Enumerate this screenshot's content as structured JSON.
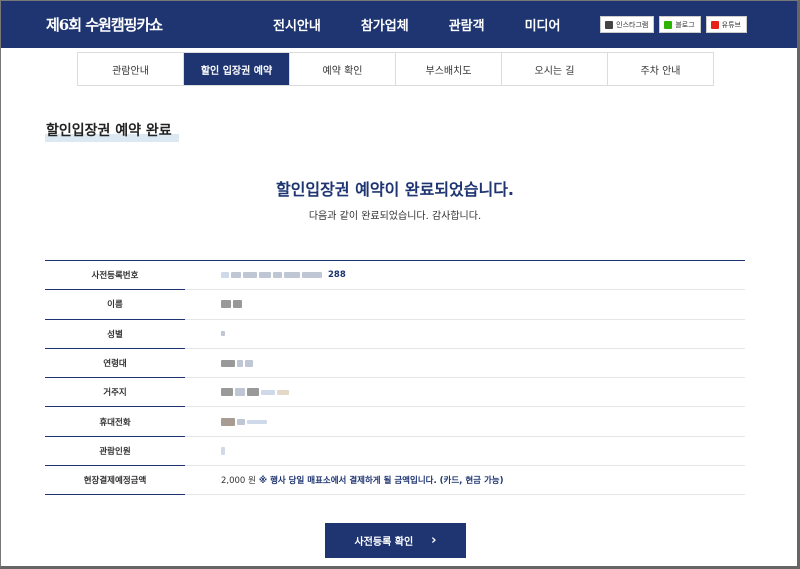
{
  "header": {
    "logo": "제6회 수원캠핑카쇼",
    "nav": [
      "전시안내",
      "참가업체",
      "관람객",
      "미디어"
    ],
    "social": [
      {
        "label": "인스타그램",
        "icon": "instagram-icon",
        "color": "#444444"
      },
      {
        "label": "블로그",
        "icon": "blog-icon",
        "color": "#2db400"
      },
      {
        "label": "유튜브",
        "icon": "youtube-icon",
        "color": "#e62117"
      }
    ]
  },
  "subtabs": {
    "items": [
      "관람안내",
      "할인 입장권 예약",
      "예약 확인",
      "부스배치도",
      "오시는 길",
      "주차 안내"
    ],
    "active_index": 1
  },
  "section": {
    "title": "할인입장권 예약 완료"
  },
  "completion": {
    "title": "할인입장권 예약이 완료되었습니다.",
    "subtitle": "다음과 같이 완료되었습니다. 감사합니다."
  },
  "details": {
    "rows": [
      {
        "label": "사전등록번호",
        "value": "288"
      },
      {
        "label": "이름",
        "value": ""
      },
      {
        "label": "성별",
        "value": ""
      },
      {
        "label": "연령대",
        "value": ""
      },
      {
        "label": "거주지",
        "value": ""
      },
      {
        "label": "휴대전화",
        "value": ""
      },
      {
        "label": "관람인원",
        "value": ""
      },
      {
        "label": "현장결제예정금액",
        "value": "2,000 원",
        "note": "※ 행사 당일 매표소에서 결제하게 될 금액입니다. (카드, 현금 가능)"
      }
    ]
  },
  "actions": {
    "confirm_label": "사전등록 확인"
  },
  "colors": {
    "brand": "#1e3572"
  }
}
